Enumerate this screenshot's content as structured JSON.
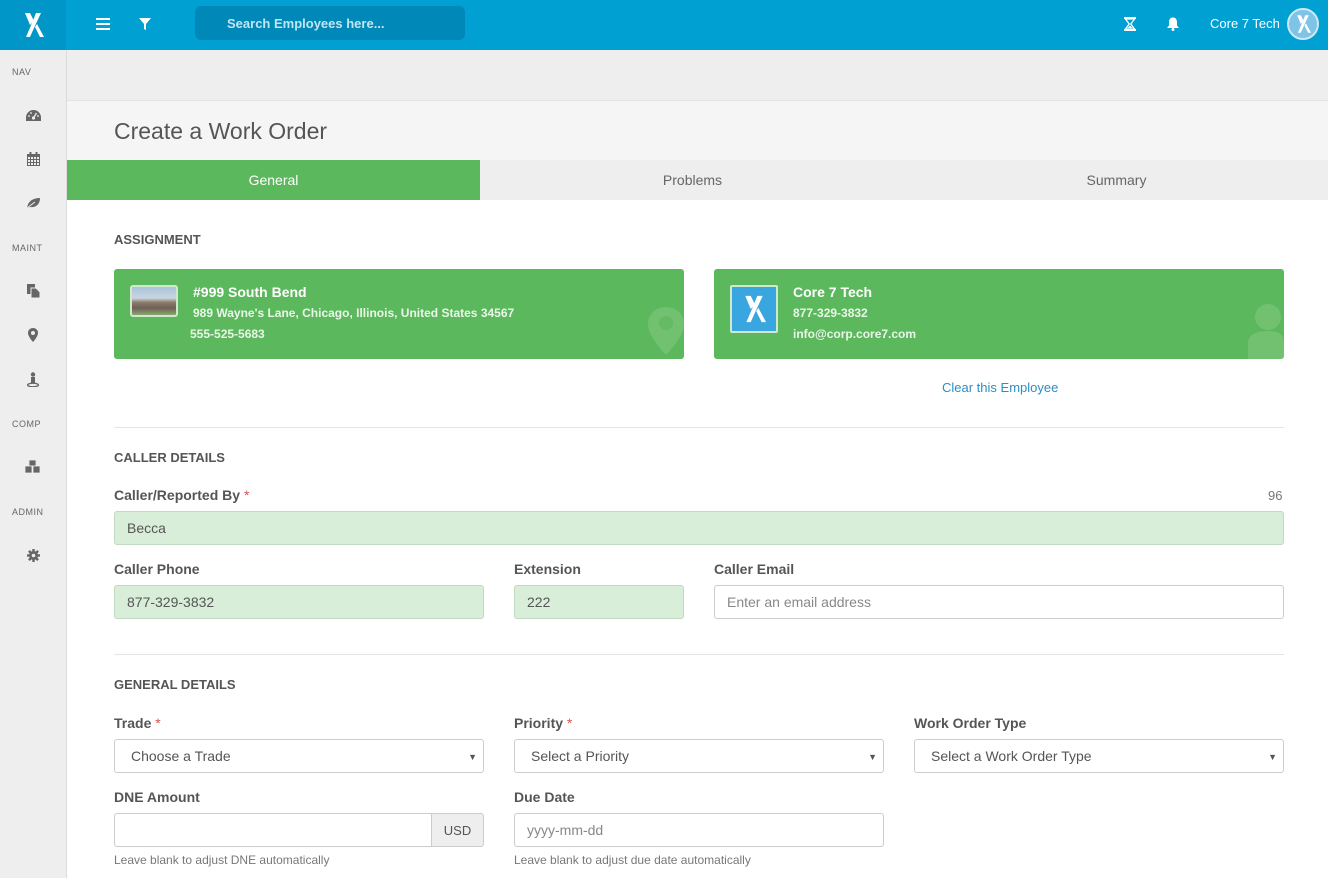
{
  "header": {
    "search_placeholder": "Search Employees here...",
    "user_name": "Core 7 Tech",
    "icons": [
      "menu-icon",
      "filter-icon",
      "hourglass-icon",
      "bell-icon"
    ]
  },
  "sidebar": {
    "sections": [
      {
        "label": "NAV",
        "items": [
          "dashboard-icon",
          "calendar-icon",
          "leaf-icon"
        ]
      },
      {
        "label": "MAINT",
        "items": [
          "documents-icon",
          "map-marker-icon",
          "person-icon"
        ]
      },
      {
        "label": "COMP",
        "items": [
          "cubes-icon"
        ]
      },
      {
        "label": "ADMIN",
        "items": [
          "gear-icon"
        ]
      }
    ]
  },
  "page": {
    "title": "Create a Work Order"
  },
  "tabs": [
    {
      "label": "General",
      "active": true
    },
    {
      "label": "Problems",
      "active": false
    },
    {
      "label": "Summary",
      "active": false
    }
  ],
  "assignment": {
    "section_title": "ASSIGNMENT",
    "location": {
      "name": "#999 South Bend",
      "address": "989 Wayne's Lane, Chicago, Illinois, United States 34567",
      "phone": "555-525-5683"
    },
    "employee": {
      "name": "Core 7 Tech",
      "phone": "877-329-3832",
      "email": "info@corp.core7.com"
    },
    "clear_link": "Clear this Employee"
  },
  "caller": {
    "section_title": "CALLER DETAILS",
    "reported_by_label": "Caller/Reported By",
    "reported_by_value": "Becca",
    "char_counter": "96",
    "phone_label": "Caller Phone",
    "phone_value": "877-329-3832",
    "extension_label": "Extension",
    "extension_value": "222",
    "email_label": "Caller Email",
    "email_placeholder": "Enter an email address"
  },
  "general": {
    "section_title": "GENERAL DETAILS",
    "trade_label": "Trade",
    "trade_value": "Choose a Trade",
    "priority_label": "Priority",
    "priority_value": "Select a Priority",
    "type_label": "Work Order Type",
    "type_value": "Select a Work Order Type",
    "dne_label": "DNE Amount",
    "dne_currency": "USD",
    "dne_help": "Leave blank to adjust DNE automatically",
    "due_label": "Due Date",
    "due_placeholder": "yyyy-mm-dd",
    "due_help": "Leave blank to adjust due date automatically"
  },
  "required_marker": "*",
  "colors": {
    "header": "#00a0d2",
    "accent_green": "#5cb85c",
    "filled_input": "#d9eed8",
    "link": "#2a8fc7",
    "required": "#d9534f"
  }
}
